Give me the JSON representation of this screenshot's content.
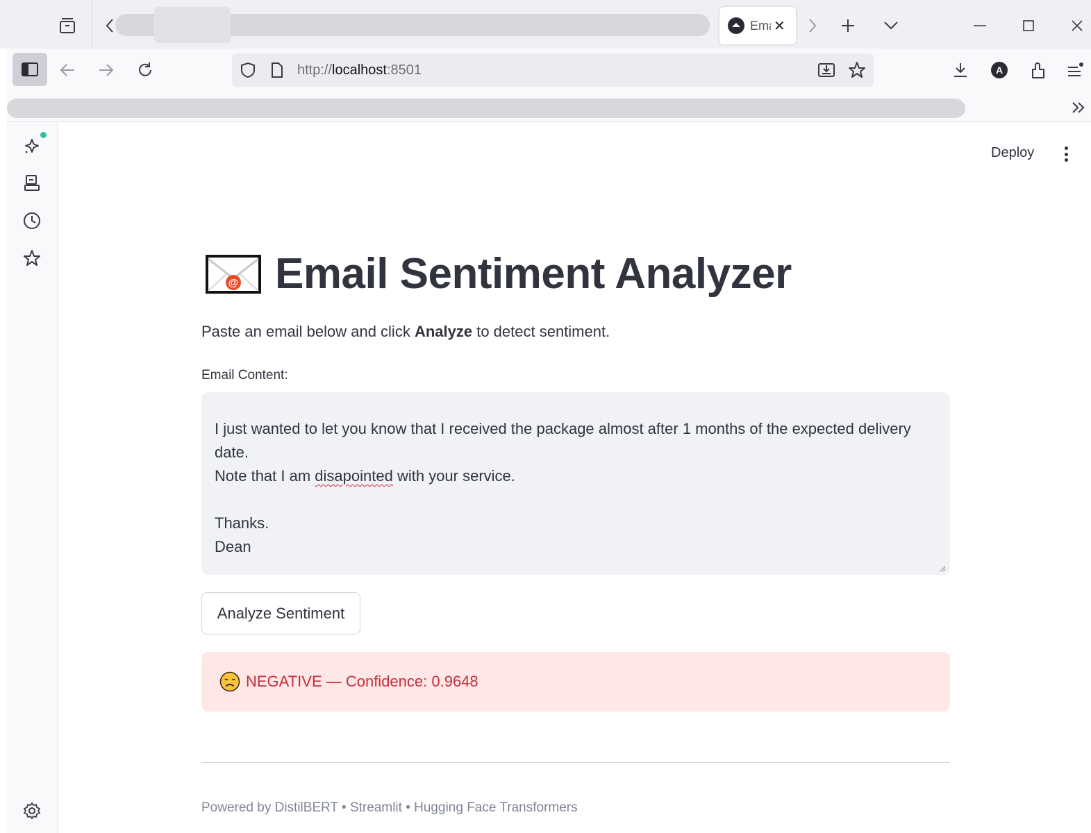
{
  "browser": {
    "tab_title": "Email Sentiment Analyzer",
    "url_prefix": "http://",
    "url_host": "localhost",
    "url_port": ":8501",
    "avatar_letter": "A"
  },
  "app": {
    "deploy_label": "Deploy",
    "title": "Email Sentiment Analyzer",
    "subtitle_before": "Paste an email below and click ",
    "subtitle_bold": "Analyze",
    "subtitle_after": " to detect sentiment.",
    "field_label": "Email Content:",
    "email": {
      "line1": "I just wanted to let you know that I received the package almost after 1 months of the expected delivery date.",
      "line2_before": "Note that I am ",
      "line2_misspelled": "disapointed",
      "line2_after": " with your service.",
      "line3": "Thanks.",
      "line4": "Dean"
    },
    "button_label": "Analyze Sentiment",
    "result": {
      "text": "NEGATIVE — Confidence: 0.9648",
      "color": "#c4303c",
      "background": "#ffe7e7"
    },
    "footer": "Powered by DistilBERT • Streamlit • Hugging Face Transformers"
  },
  "icons": {
    "tabbar": [
      "tab-overview-icon",
      "scroll-left-icon",
      "scroll-right-icon",
      "new-tab-icon",
      "tab-list-icon",
      "minimize-icon",
      "maximize-icon",
      "close-window-icon"
    ],
    "navbar": [
      "sidebar-toggle-icon",
      "back-icon",
      "forward-icon",
      "reload-icon",
      "shield-icon",
      "page-icon",
      "install-icon",
      "bookmark-star-icon",
      "downloads-icon",
      "account-icon",
      "extensions-icon",
      "menu-icon",
      "overflow-icon"
    ],
    "sidebar": [
      "ai-sparkle-icon",
      "synced-tabs-icon",
      "history-icon",
      "bookmarks-icon",
      "settings-icon"
    ]
  }
}
